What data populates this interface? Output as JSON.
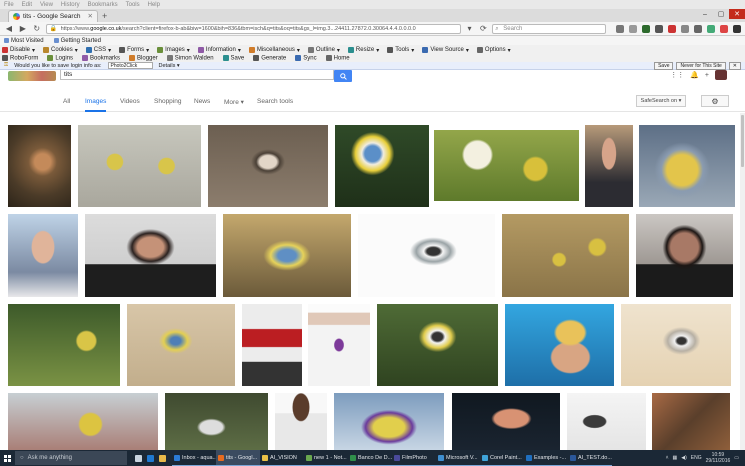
{
  "browser": {
    "menu": [
      "File",
      "Edit",
      "View",
      "History",
      "Bookmarks",
      "Tools",
      "Help"
    ],
    "tab_title": "tits - Google Search",
    "url_prefix": "https://www.",
    "url_domain": "google.co.uk",
    "url_rest": "/search?client=firefox-b-ab&biw=1600&bih=836&tbm=isch&q=tits&oq=tits&gs_l=img.3...24411.27872.0.30064.4.4.0.0.0.0",
    "search_placeholder": "Search",
    "bookmarks": [
      "Most Visited",
      "Getting Started"
    ],
    "webdev_row1": [
      "Disable",
      "Cookies",
      "CSS",
      "Forms",
      "Images",
      "Information",
      "Miscellaneous",
      "Outline",
      "Resize",
      "Tools",
      "View Source",
      "Options"
    ],
    "webdev_row2": [
      "RoboForm",
      "Logins",
      "Bookmarks",
      "Blogger",
      "Simon Walden",
      "Save",
      "Generate",
      "Sync",
      "Home"
    ],
    "password_prompt": "Would you like to save login info as:",
    "password_user": "Photo2Click",
    "password_details": "Details",
    "save_button": "Save",
    "never_button": "Never for This Site"
  },
  "google": {
    "query": "tits",
    "tabs": [
      "All",
      "Images",
      "Videos",
      "Shopping",
      "News",
      "More",
      "Search tools"
    ],
    "active_tab": "Images",
    "safesearch": "SafeSearch on",
    "gear_icon": "gear-icon"
  },
  "taskbar": {
    "search_placeholder": "Ask me anything",
    "items": [
      "Inbox - aqua...",
      "tits - Googl...",
      "AI_VISION",
      "new 1 - Not...",
      "Banco De D...",
      "FilmPhoto",
      "Microsoft V...",
      "Corel Paint...",
      "Examples -...",
      "AI_TEST.do..."
    ],
    "lang": "ENG",
    "time": "10:59",
    "date": "29/11/2016"
  }
}
